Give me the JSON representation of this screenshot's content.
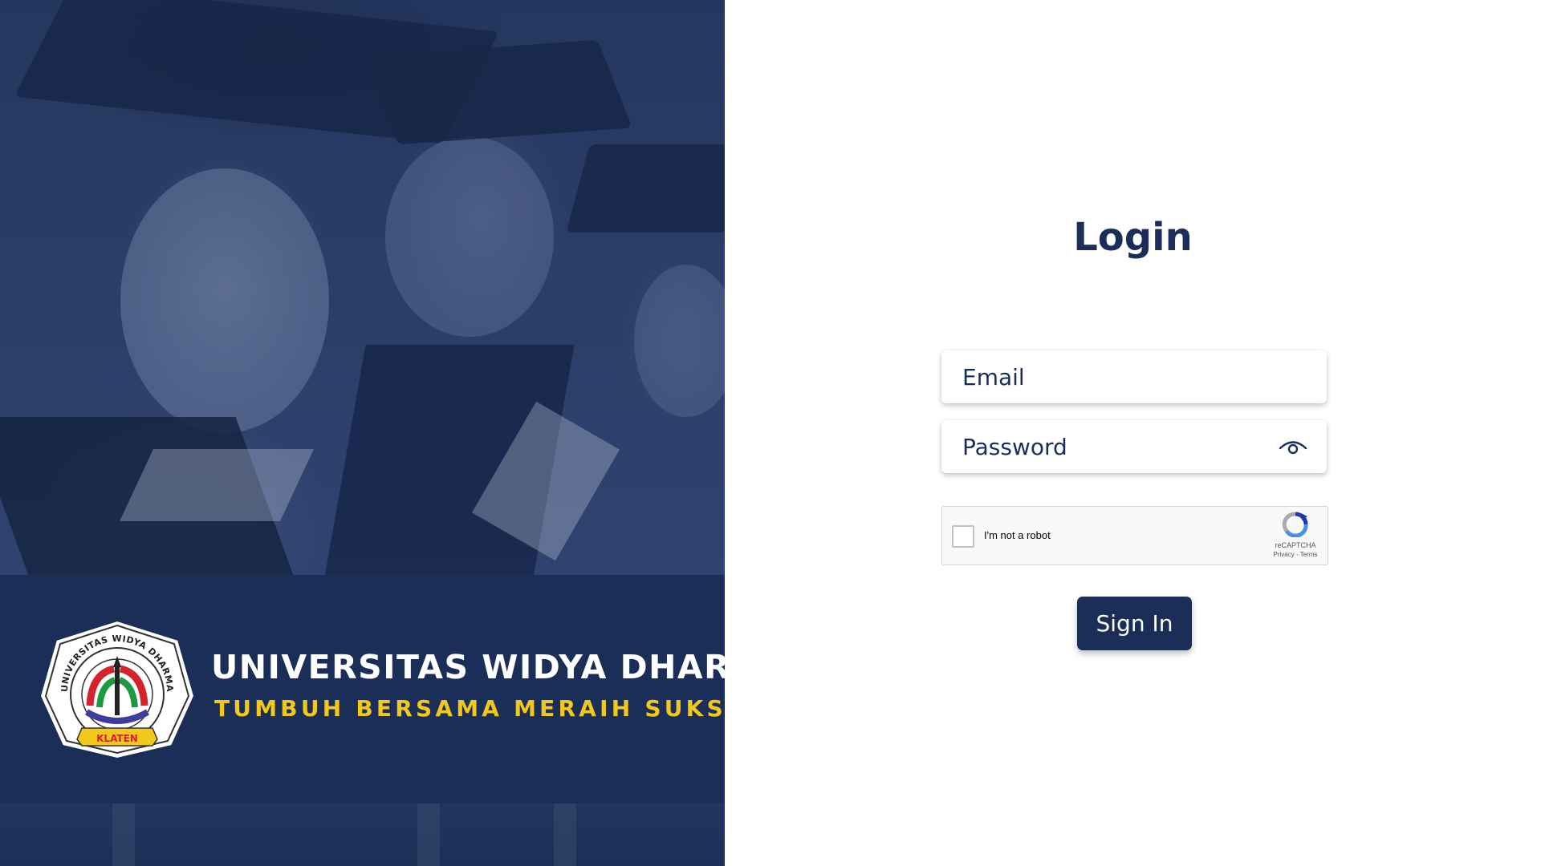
{
  "branding": {
    "university_name": "UNIVERSITAS WIDYA DHARMA",
    "tagline": "TUMBUH BERSAMA MERAIH SUKSES",
    "seal_top_text": "UNIVERSITAS WIDYA DHARMA",
    "seal_ribbon_text": "KLATEN",
    "colors": {
      "navy": "#1b2e58",
      "gold": "#f2c81b"
    }
  },
  "login": {
    "title": "Login",
    "email": {
      "placeholder": "Email",
      "value": ""
    },
    "password": {
      "placeholder": "Password",
      "value": "",
      "toggle_icon": "eye-icon"
    },
    "recaptcha": {
      "label": "I'm not a robot",
      "brand": "reCAPTCHA",
      "links": "Privacy - Terms",
      "checked": false
    },
    "submit_label": "Sign In"
  }
}
